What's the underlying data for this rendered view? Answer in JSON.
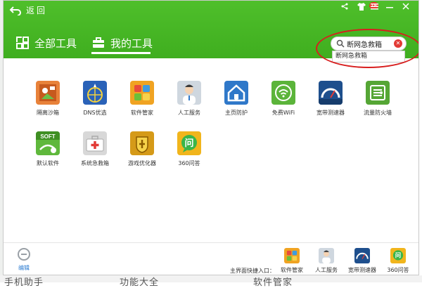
{
  "window": {
    "back_label": "返回",
    "notification_count": "18"
  },
  "tabs": [
    {
      "label": "全部工具",
      "active": false
    },
    {
      "label": "我的工具",
      "active": true
    }
  ],
  "search": {
    "value": "断网急救箱",
    "suggestion": "断网急救箱"
  },
  "tools": [
    {
      "label": "隔离沙箱",
      "icon": "sandbox-icon",
      "color": "#e8823a"
    },
    {
      "label": "DNS优选",
      "icon": "dns-globe-icon",
      "color": "#2a62b8"
    },
    {
      "label": "软件管家",
      "icon": "software-manager-icon",
      "color": "#f0a322"
    },
    {
      "label": "人工服务",
      "icon": "service-person-icon",
      "color": "#cfd7df"
    },
    {
      "label": "主页防护",
      "icon": "home-shield-icon",
      "color": "#2f78c9"
    },
    {
      "label": "免费WiFi",
      "icon": "wifi-icon",
      "color": "#5bb43a"
    },
    {
      "label": "宽带测速器",
      "icon": "speedometer-icon",
      "color": "#1e4f8d"
    },
    {
      "label": "流量防火墙",
      "icon": "firewall-icon",
      "color": "#55a635"
    },
    {
      "label": "默认软件",
      "icon": "default-software-icon",
      "color": "#5fb83c"
    },
    {
      "label": "系统急救箱",
      "icon": "first-aid-kit-icon",
      "color": "#d8d8d8"
    },
    {
      "label": "游戏优化器",
      "icon": "game-optimizer-icon",
      "color": "#d59a18"
    },
    {
      "label": "360问答",
      "icon": "qa-icon",
      "color": "#f1b51c"
    }
  ],
  "footer": {
    "edit_label": "编辑",
    "shortcut_label": "主界面快捷入口：",
    "quick_entries": [
      {
        "label": "软件管家",
        "icon": "software-manager-icon"
      },
      {
        "label": "人工服务",
        "icon": "service-person-icon"
      },
      {
        "label": "宽带测速器",
        "icon": "speedometer-icon"
      },
      {
        "label": "360问答",
        "icon": "qa-icon"
      }
    ]
  },
  "background": {
    "bottom_texts": [
      "手机助手",
      "功能大全",
      "软件管家"
    ]
  }
}
